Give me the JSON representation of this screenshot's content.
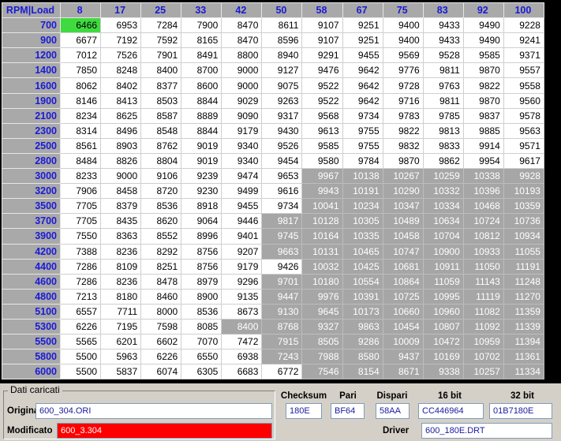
{
  "map": {
    "corner": "RPM|Load",
    "loads": [
      "8",
      "17",
      "25",
      "33",
      "42",
      "50",
      "58",
      "67",
      "75",
      "83",
      "92",
      "100"
    ],
    "rows": [
      {
        "rpm": "700",
        "values": [
          "6466",
          "6953",
          "7284",
          "7900",
          "8470",
          "8611",
          "9107",
          "9251",
          "9400",
          "9433",
          "9490",
          "9228"
        ]
      },
      {
        "rpm": "900",
        "values": [
          "6677",
          "7192",
          "7592",
          "8165",
          "8470",
          "8596",
          "9107",
          "9251",
          "9400",
          "9433",
          "9490",
          "9241"
        ]
      },
      {
        "rpm": "1200",
        "values": [
          "7012",
          "7526",
          "7901",
          "8491",
          "8800",
          "8940",
          "9291",
          "9455",
          "9569",
          "9528",
          "9585",
          "9371"
        ]
      },
      {
        "rpm": "1400",
        "values": [
          "7850",
          "8248",
          "8400",
          "8700",
          "9000",
          "9127",
          "9476",
          "9642",
          "9776",
          "9811",
          "9870",
          "9557"
        ]
      },
      {
        "rpm": "1600",
        "values": [
          "8062",
          "8402",
          "8377",
          "8600",
          "9000",
          "9075",
          "9522",
          "9642",
          "9728",
          "9763",
          "9822",
          "9558"
        ]
      },
      {
        "rpm": "1900",
        "values": [
          "8146",
          "8413",
          "8503",
          "8844",
          "9029",
          "9263",
          "9522",
          "9642",
          "9716",
          "9811",
          "9870",
          "9560"
        ]
      },
      {
        "rpm": "2100",
        "values": [
          "8234",
          "8625",
          "8587",
          "8889",
          "9090",
          "9317",
          "9568",
          "9734",
          "9783",
          "9785",
          "9837",
          "9578"
        ]
      },
      {
        "rpm": "2300",
        "values": [
          "8314",
          "8496",
          "8548",
          "8844",
          "9179",
          "9430",
          "9613",
          "9755",
          "9822",
          "9813",
          "9885",
          "9563"
        ]
      },
      {
        "rpm": "2500",
        "values": [
          "8561",
          "8903",
          "8762",
          "9019",
          "9340",
          "9526",
          "9585",
          "9755",
          "9832",
          "9833",
          "9914",
          "9571"
        ]
      },
      {
        "rpm": "2800",
        "values": [
          "8484",
          "8826",
          "8804",
          "9019",
          "9340",
          "9454",
          "9580",
          "9784",
          "9870",
          "9862",
          "9954",
          "9617"
        ]
      },
      {
        "rpm": "3000",
        "values": [
          "8233",
          "9000",
          "9106",
          "9239",
          "9474",
          "9653",
          "9967",
          "10138",
          "10267",
          "10259",
          "10338",
          "9928"
        ]
      },
      {
        "rpm": "3200",
        "values": [
          "7906",
          "8458",
          "8720",
          "9230",
          "9499",
          "9616",
          "9943",
          "10191",
          "10290",
          "10332",
          "10396",
          "10193"
        ]
      },
      {
        "rpm": "3500",
        "values": [
          "7705",
          "8379",
          "8536",
          "8918",
          "9455",
          "9734",
          "10041",
          "10234",
          "10347",
          "10334",
          "10468",
          "10359"
        ]
      },
      {
        "rpm": "3700",
        "values": [
          "7705",
          "8435",
          "8620",
          "9064",
          "9446",
          "9817",
          "10128",
          "10305",
          "10489",
          "10634",
          "10724",
          "10736"
        ]
      },
      {
        "rpm": "3900",
        "values": [
          "7550",
          "8363",
          "8552",
          "8996",
          "9401",
          "9745",
          "10164",
          "10335",
          "10458",
          "10704",
          "10812",
          "10934"
        ]
      },
      {
        "rpm": "4200",
        "values": [
          "7388",
          "8236",
          "8292",
          "8756",
          "9207",
          "9663",
          "10131",
          "10465",
          "10747",
          "10900",
          "10933",
          "11055"
        ]
      },
      {
        "rpm": "4400",
        "values": [
          "7286",
          "8109",
          "8251",
          "8756",
          "9179",
          "9426",
          "10032",
          "10425",
          "10681",
          "10911",
          "11050",
          "11191"
        ]
      },
      {
        "rpm": "4600",
        "values": [
          "7286",
          "8236",
          "8478",
          "8979",
          "9296",
          "9701",
          "10180",
          "10554",
          "10864",
          "11059",
          "11143",
          "11248"
        ]
      },
      {
        "rpm": "4800",
        "values": [
          "7213",
          "8180",
          "8460",
          "8900",
          "9135",
          "9447",
          "9976",
          "10391",
          "10725",
          "10995",
          "11119",
          "11270"
        ]
      },
      {
        "rpm": "5100",
        "values": [
          "6557",
          "7711",
          "8000",
          "8536",
          "8673",
          "9130",
          "9645",
          "10173",
          "10660",
          "10960",
          "11082",
          "11359"
        ]
      },
      {
        "rpm": "5300",
        "values": [
          "6226",
          "7195",
          "7598",
          "8085",
          "8400",
          "8768",
          "9327",
          "9863",
          "10454",
          "10807",
          "11092",
          "11339"
        ]
      },
      {
        "rpm": "5500",
        "values": [
          "5565",
          "6201",
          "6602",
          "7070",
          "7472",
          "7915",
          "8505",
          "9286",
          "10009",
          "10472",
          "10959",
          "11394"
        ]
      },
      {
        "rpm": "5800",
        "values": [
          "5500",
          "5963",
          "6226",
          "6550",
          "6938",
          "7243",
          "7988",
          "8580",
          "9437",
          "10169",
          "10702",
          "11361"
        ]
      },
      {
        "rpm": "6000",
        "values": [
          "5500",
          "5837",
          "6074",
          "6305",
          "6683",
          "6772",
          "7546",
          "8154",
          "8671",
          "9338",
          "10257",
          "11334"
        ]
      }
    ],
    "highlight": [
      [
        10,
        6
      ],
      [
        10,
        7
      ],
      [
        10,
        8
      ],
      [
        10,
        9
      ],
      [
        10,
        10
      ],
      [
        10,
        11
      ],
      [
        11,
        6
      ],
      [
        11,
        7
      ],
      [
        11,
        8
      ],
      [
        11,
        9
      ],
      [
        11,
        10
      ],
      [
        11,
        11
      ],
      [
        12,
        6
      ],
      [
        12,
        7
      ],
      [
        12,
        8
      ],
      [
        12,
        9
      ],
      [
        12,
        10
      ],
      [
        12,
        11
      ],
      [
        13,
        5
      ],
      [
        13,
        6
      ],
      [
        13,
        7
      ],
      [
        13,
        8
      ],
      [
        13,
        9
      ],
      [
        13,
        10
      ],
      [
        13,
        11
      ],
      [
        14,
        5
      ],
      [
        14,
        6
      ],
      [
        14,
        7
      ],
      [
        14,
        8
      ],
      [
        14,
        9
      ],
      [
        14,
        10
      ],
      [
        14,
        11
      ],
      [
        15,
        5
      ],
      [
        15,
        6
      ],
      [
        15,
        7
      ],
      [
        15,
        8
      ],
      [
        15,
        9
      ],
      [
        15,
        10
      ],
      [
        15,
        11
      ],
      [
        16,
        6
      ],
      [
        16,
        7
      ],
      [
        16,
        8
      ],
      [
        16,
        9
      ],
      [
        16,
        10
      ],
      [
        16,
        11
      ],
      [
        17,
        5
      ],
      [
        17,
        6
      ],
      [
        17,
        7
      ],
      [
        17,
        8
      ],
      [
        17,
        9
      ],
      [
        17,
        10
      ],
      [
        17,
        11
      ],
      [
        18,
        5
      ],
      [
        18,
        6
      ],
      [
        18,
        7
      ],
      [
        18,
        8
      ],
      [
        18,
        9
      ],
      [
        18,
        10
      ],
      [
        18,
        11
      ],
      [
        19,
        5
      ],
      [
        19,
        6
      ],
      [
        19,
        7
      ],
      [
        19,
        8
      ],
      [
        19,
        9
      ],
      [
        19,
        10
      ],
      [
        19,
        11
      ],
      [
        20,
        4
      ],
      [
        20,
        5
      ],
      [
        20,
        6
      ],
      [
        20,
        7
      ],
      [
        20,
        8
      ],
      [
        20,
        9
      ],
      [
        20,
        10
      ],
      [
        20,
        11
      ],
      [
        21,
        5
      ],
      [
        21,
        6
      ],
      [
        21,
        7
      ],
      [
        21,
        8
      ],
      [
        21,
        9
      ],
      [
        21,
        10
      ],
      [
        21,
        11
      ],
      [
        22,
        5
      ],
      [
        22,
        6
      ],
      [
        22,
        7
      ],
      [
        22,
        8
      ],
      [
        22,
        9
      ],
      [
        22,
        10
      ],
      [
        22,
        11
      ],
      [
        23,
        6
      ],
      [
        23,
        7
      ],
      [
        23,
        8
      ],
      [
        23,
        9
      ],
      [
        23,
        10
      ],
      [
        23,
        11
      ]
    ],
    "selected": [
      0,
      0
    ],
    "colors": {
      "header_bg": "#a9a9a9",
      "header_text": "#1a1ad6",
      "highlight_bg": "#a6a6a6",
      "selected_bg": "#3fda3f"
    }
  },
  "info": {
    "group_title": "Dati caricati",
    "originale_label": "Originale",
    "originale_value": "600_304.ORI",
    "modificato_label": "Modificato",
    "modificato_value": "600_3.304",
    "checksum_label": "Checksum",
    "checksum_value": "180E",
    "pari_label": "Pari",
    "pari_value": "BF64",
    "dispari_label": "Dispari",
    "dispari_value": "58AA",
    "bit16_label": "16 bit",
    "bit16_value": "CC446964",
    "bit32_label": "32 bit",
    "bit32_value": "01B7180E",
    "driver_label": "Driver",
    "driver_value": "600_180E.DRT"
  }
}
